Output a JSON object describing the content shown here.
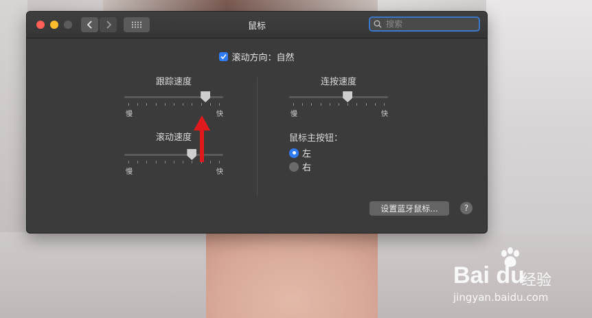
{
  "window": {
    "title": "鼠标",
    "search_placeholder": "搜索"
  },
  "scroll_direction": {
    "label": "滚动方向：自然",
    "checked": true
  },
  "tracking_speed": {
    "label": "跟踪速度",
    "slow": "慢",
    "fast": "快",
    "value_fraction": 0.85
  },
  "scrolling_speed": {
    "label": "滚动速度",
    "slow": "慢",
    "fast": "快",
    "value_fraction": 0.7
  },
  "double_click_speed": {
    "label": "连按速度",
    "slow": "慢",
    "fast": "快",
    "value_fraction": 0.6
  },
  "primary_button": {
    "label": "鼠标主按钮：",
    "options": [
      "左",
      "右"
    ],
    "selected": "左"
  },
  "bluetooth_button": "设置蓝牙鼠标...",
  "help_button": "?",
  "watermark": {
    "brand": "Bai du",
    "product": "经验",
    "url": "jingyan.baidu.com"
  },
  "colors": {
    "accent": "#2f7cf6",
    "annotation_arrow": "#e0191c"
  }
}
